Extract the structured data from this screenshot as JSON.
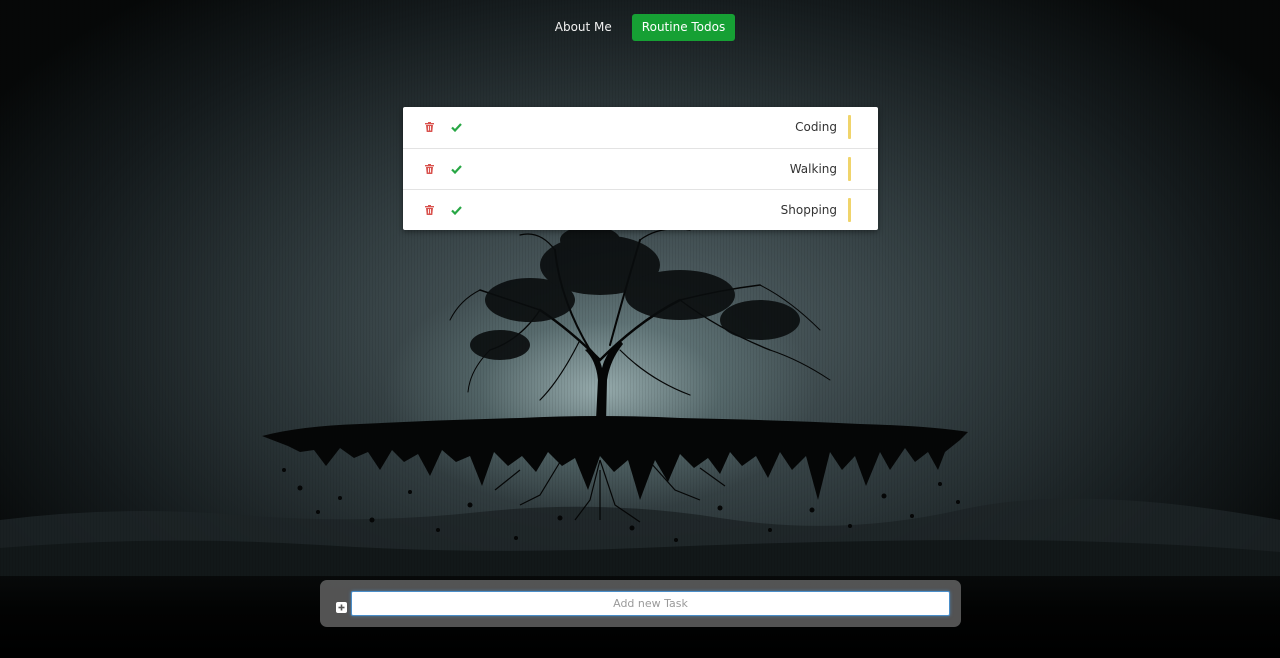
{
  "nav": {
    "items": [
      {
        "label": "About Me",
        "active": false
      },
      {
        "label": "Routine Todos",
        "active": true
      }
    ]
  },
  "todos": [
    {
      "label": "Coding",
      "delete_icon": "trash-icon",
      "done_icon": "check-icon",
      "priority_color": "#f0d46b"
    },
    {
      "label": "Walking",
      "delete_icon": "trash-icon",
      "done_icon": "check-icon",
      "priority_color": "#f0d46b"
    },
    {
      "label": "Shopping",
      "delete_icon": "trash-icon",
      "done_icon": "check-icon",
      "priority_color": "#f0d46b"
    }
  ],
  "add_task": {
    "icon": "plus-square-icon",
    "placeholder": "Add new Task",
    "value": ""
  },
  "colors": {
    "accent": "#16a034",
    "delete": "#d9534f",
    "done": "#28a745"
  }
}
